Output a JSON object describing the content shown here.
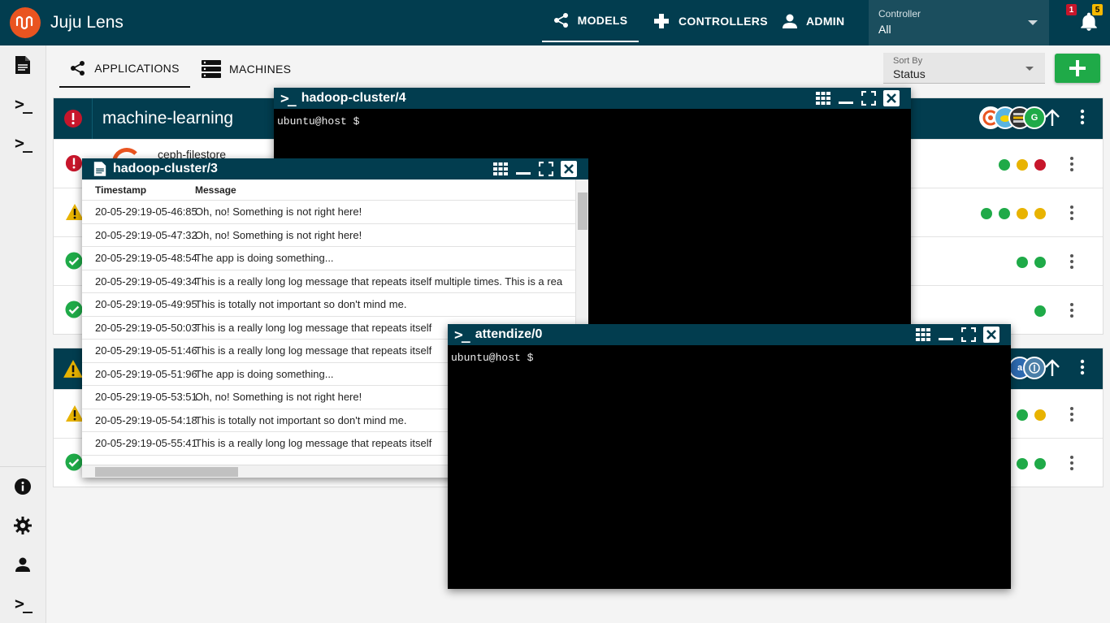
{
  "header": {
    "app_title": "Juju Lens",
    "nav": [
      {
        "label": "MODELS",
        "active": true
      },
      {
        "label": "CONTROLLERS",
        "active": false
      },
      {
        "label": "ADMIN",
        "active": false
      }
    ],
    "controller": {
      "label": "Controller",
      "value": "All"
    },
    "notifications": {
      "error_count": "1",
      "warning_count": "5"
    }
  },
  "toolbar": {
    "tabs": [
      {
        "label": "APPLICATIONS",
        "active": true
      },
      {
        "label": "MACHINES",
        "active": false
      }
    ],
    "sort_by": {
      "label": "Sort By",
      "value": "Status"
    }
  },
  "models": [
    {
      "name": "machine-learning",
      "status": "error",
      "rows": [
        {
          "status": "error",
          "name": "ceph-filestore",
          "units": [
            "g",
            "y",
            "r"
          ]
        },
        {
          "status": "warning",
          "name": "",
          "units": [
            "g",
            "g",
            "y",
            "y"
          ]
        },
        {
          "status": "ok",
          "name": "",
          "units": [
            "g",
            "g"
          ]
        },
        {
          "status": "ok",
          "name": "",
          "units": [
            "g"
          ]
        }
      ]
    },
    {
      "name": "",
      "status": "warning",
      "rows": [
        {
          "status": "warning",
          "name": "",
          "units": [
            "g",
            "y"
          ]
        },
        {
          "status": "ok",
          "name": "",
          "units": [
            "g",
            "g"
          ]
        }
      ]
    }
  ],
  "windows": {
    "terminal_hadoop4": {
      "title": "hadoop-cluster/4",
      "prompt": "ubuntu@host $"
    },
    "log_hadoop3": {
      "title": "hadoop-cluster/3",
      "columns": [
        "Timestamp",
        "Message"
      ],
      "rows": [
        {
          "ts": "20-05-29:19-05-46:85",
          "msg": "Oh, no! Something is not right here!"
        },
        {
          "ts": "20-05-29:19-05-47:32",
          "msg": "Oh, no! Something is not right here!"
        },
        {
          "ts": "20-05-29:19-05-48:54",
          "msg": "The app is doing something..."
        },
        {
          "ts": "20-05-29:19-05-49:34",
          "msg": "This is a really long log message that repeats itself multiple times. This is a rea"
        },
        {
          "ts": "20-05-29:19-05-49:95",
          "msg": "This is totally not important so don't mind me."
        },
        {
          "ts": "20-05-29:19-05-50:03",
          "msg": "This is a really long log message that repeats itself"
        },
        {
          "ts": "20-05-29:19-05-51:46",
          "msg": "This is a really long log message that repeats itself"
        },
        {
          "ts": "20-05-29:19-05-51:96",
          "msg": "The app is doing something..."
        },
        {
          "ts": "20-05-29:19-05-53:51",
          "msg": "Oh, no! Something is not right here!"
        },
        {
          "ts": "20-05-29:19-05-54:18",
          "msg": "This is totally not important so don't mind me."
        },
        {
          "ts": "20-05-29:19-05-55:41",
          "msg": "This is a really long log message that repeats itself"
        }
      ]
    },
    "terminal_attendize": {
      "title": "attendize/0",
      "prompt": "ubuntu@host $"
    }
  },
  "colors": {
    "brand": "#023d4f",
    "accent": "#e95420",
    "ok": "#1faa48",
    "warning": "#e8b300",
    "error": "#c7162b"
  }
}
